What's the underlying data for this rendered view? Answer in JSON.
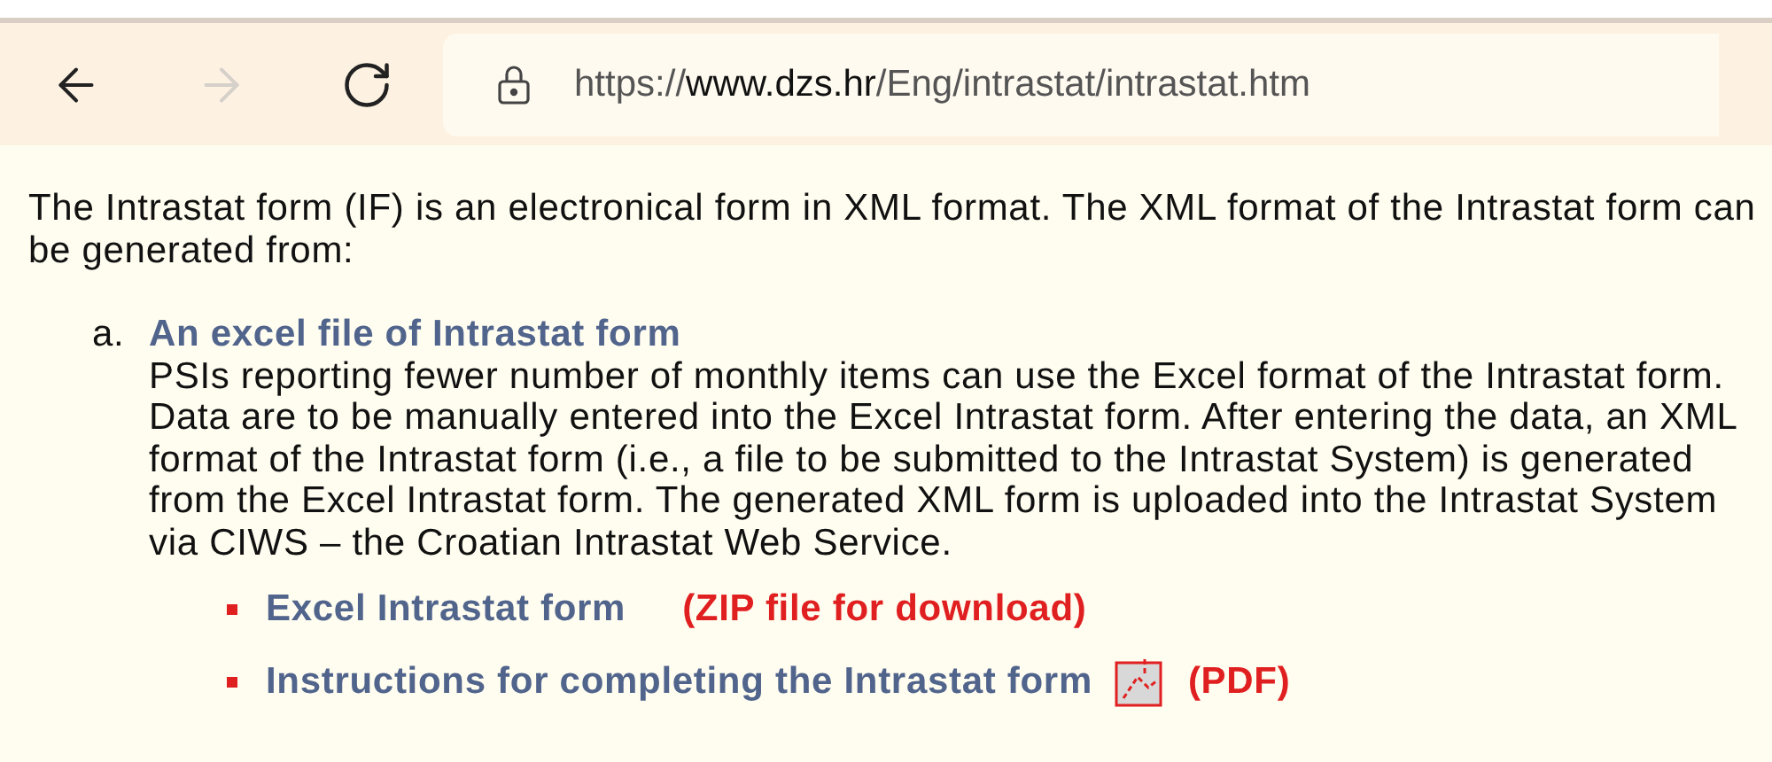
{
  "toolbar": {
    "back": {
      "disabled": false
    },
    "forward": {
      "disabled": true
    },
    "address": {
      "scheme": "https://",
      "host": "www.dzs.hr",
      "path": "/Eng/intrastat/intrastat.htm"
    }
  },
  "intro": "The Intrastat form (IF) is an electronical form in XML format. The XML format of the Intrastat form can be generated from:",
  "items": [
    {
      "marker": "a.",
      "title": "An excel file of Intrastat form",
      "description": "PSIs reporting fewer number of monthly items can use the Excel format of the Intrastat form. Data are to be manually entered into the Excel Intrastat form. After entering the data, an XML format of the Intrastat form (i.e., a file to be submitted to the Intrastat System) is generated from the Excel Intrastat form. The generated XML form is uploaded into the Intrastat System via CIWS – the Croatian Intrastat Web Service.",
      "links": [
        {
          "label": "Excel Intrastat form",
          "icon": false,
          "note": "(ZIP file for download)"
        },
        {
          "label": "Instructions for completing the Intrastat form",
          "icon": true,
          "note": "(PDF)"
        }
      ]
    }
  ]
}
